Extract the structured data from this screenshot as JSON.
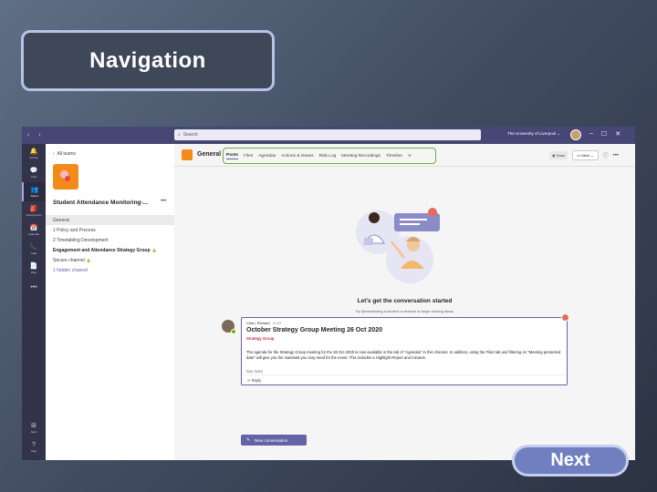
{
  "slide": {
    "title": "Navigation",
    "next_label": "Next"
  },
  "teams": {
    "titlebar": {
      "search_placeholder": "Search",
      "org_name": "The University of Liverpool"
    },
    "rail": [
      {
        "icon": "bell-icon",
        "glyph": "🔔",
        "label": "Activity"
      },
      {
        "icon": "chat-icon",
        "glyph": "💬",
        "label": "Chat"
      },
      {
        "icon": "teams-icon",
        "glyph": "👥",
        "label": "Teams",
        "active": true
      },
      {
        "icon": "assignments-icon",
        "glyph": "🎒",
        "label": "Assignments"
      },
      {
        "icon": "calendar-icon",
        "glyph": "📅",
        "label": "Calendar"
      },
      {
        "icon": "calls-icon",
        "glyph": "📞",
        "label": "Calls"
      },
      {
        "icon": "files-icon",
        "glyph": "📄",
        "label": "Files"
      }
    ],
    "rail_more": "•••",
    "rail_bottom": [
      {
        "icon": "apps-icon",
        "glyph": "⊞",
        "label": "Apps"
      },
      {
        "icon": "help-icon",
        "glyph": "?",
        "label": "Help"
      }
    ],
    "panel": {
      "back_label": "All teams",
      "team_name": "Student Attendance Monitoring-...",
      "more": "•••",
      "channels": [
        {
          "label": "General",
          "style": "sel"
        },
        {
          "label": "1 Policy and Process",
          "style": ""
        },
        {
          "label": "2 Timetabling Development",
          "style": ""
        },
        {
          "label": "Engagement and Attendance Strategy Group",
          "style": "bold",
          "lock": true
        },
        {
          "label": "Secure channel",
          "style": "",
          "lock": true
        },
        {
          "label": "1 hidden channel",
          "style": "link"
        }
      ]
    },
    "header": {
      "channel_name": "General",
      "tabs": [
        "Posts",
        "Files",
        "Agendas",
        "Actions & Issues",
        "Risk Log",
        "Meeting Recordings",
        "Timeline"
      ],
      "active_tab": "Posts",
      "team_pill": "Team",
      "meet_label": "Meet"
    },
    "conversation": {
      "title": "Let's get the conversation started",
      "subtitle": "Try @mentioning a student or teacher to begin sharing ideas."
    },
    "post": {
      "author": "Chen, Richard",
      "time": "11/02",
      "subject": "October Strategy Group Meeting 26 Oct 2020",
      "group": "Strategy Group",
      "body": "The agenda for the Strategy Group meeting for the 26 Oct 2020 is now available in the tab of \"Agendas\" in this channel. In addition, using the Files tab and filtering on \"Meeting presented date\" will give you the materials you may need for the event. This includes a Highlight Report and minutes.",
      "see_more": "See more",
      "reply": "Reply"
    },
    "new_conversation": "New conversation"
  },
  "colors": {
    "teams_purple": "#6264a7",
    "titlebar": "#464775",
    "rail": "#33344a",
    "highlight_green": "#6fae3c",
    "brand_orange": "#f28b1a"
  }
}
